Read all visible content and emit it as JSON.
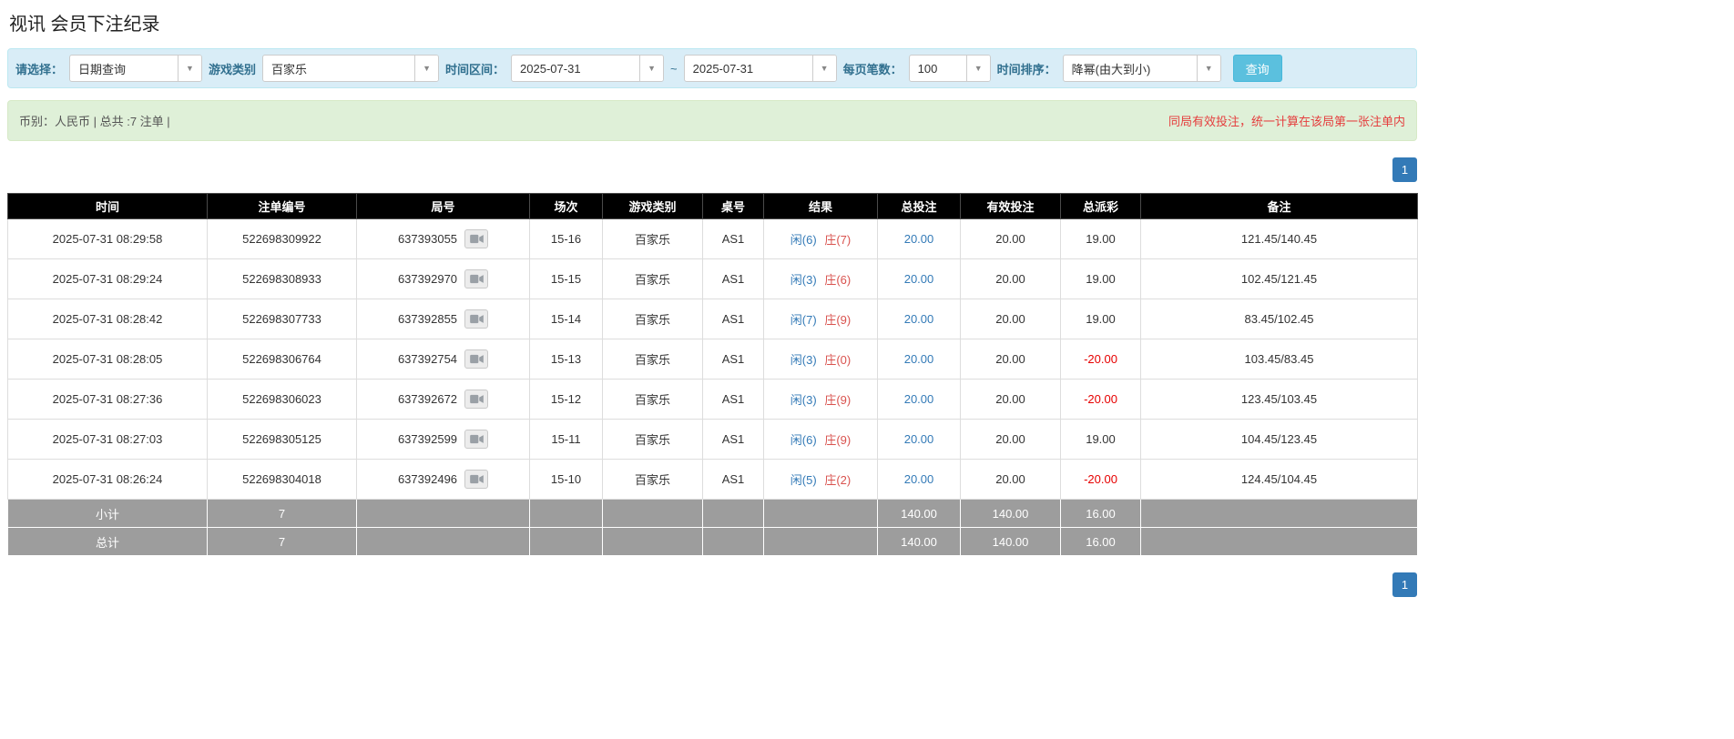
{
  "page": {
    "title": "视讯 会员下注纪录"
  },
  "colors": {
    "accent_blue": "#337ab7",
    "player_blue": "#337ab7",
    "banker_red": "#d9534f",
    "negative_red": "#e60000",
    "filter_bar_bg": "#d9edf7",
    "summary_bar_bg": "#dff0d8",
    "table_header_bg": "#000000",
    "table_footer_bg": "#9d9d9d",
    "search_button_bg": "#5bc0de"
  },
  "filters": {
    "select_label": "请选择：",
    "select_value": "日期查询",
    "game_type_label": "游戏类别",
    "game_type_value": "百家乐",
    "time_range_label": "时间区间：",
    "time_from": "2025-07-31",
    "tilde": "~",
    "time_to": "2025-07-31",
    "page_size_label": "每页笔数：",
    "page_size_value": "100",
    "sort_label": "时间排序：",
    "sort_value": "降幂(由大到小)",
    "search_button": "查询"
  },
  "summary": {
    "left": "币别：人民币 | 总共 :7 注单 |",
    "right": "同局有效投注，统一计算在该局第一张注单内"
  },
  "pagination": {
    "page": "1"
  },
  "table": {
    "headers": [
      "时间",
      "注单编号",
      "局号",
      "场次",
      "游戏类别",
      "桌号",
      "结果",
      "总投注",
      "有效投注",
      "总派彩",
      "备注"
    ],
    "rows": [
      {
        "time": "2025-07-31 08:29:58",
        "bet_id": "522698309922",
        "round_id": "637393055",
        "session": "15-16",
        "game": "百家乐",
        "table_no": "AS1",
        "result_player": "闲(6)",
        "result_banker": "庄(7)",
        "total_bet": "20.00",
        "valid_bet": "20.00",
        "payout": "19.00",
        "note": "121.45/140.45"
      },
      {
        "time": "2025-07-31 08:29:24",
        "bet_id": "522698308933",
        "round_id": "637392970",
        "session": "15-15",
        "game": "百家乐",
        "table_no": "AS1",
        "result_player": "闲(3)",
        "result_banker": "庄(6)",
        "total_bet": "20.00",
        "valid_bet": "20.00",
        "payout": "19.00",
        "note": "102.45/121.45"
      },
      {
        "time": "2025-07-31 08:28:42",
        "bet_id": "522698307733",
        "round_id": "637392855",
        "session": "15-14",
        "game": "百家乐",
        "table_no": "AS1",
        "result_player": "闲(7)",
        "result_banker": "庄(9)",
        "total_bet": "20.00",
        "valid_bet": "20.00",
        "payout": "19.00",
        "note": "83.45/102.45"
      },
      {
        "time": "2025-07-31 08:28:05",
        "bet_id": "522698306764",
        "round_id": "637392754",
        "session": "15-13",
        "game": "百家乐",
        "table_no": "AS1",
        "result_player": "闲(3)",
        "result_banker": "庄(0)",
        "total_bet": "20.00",
        "valid_bet": "20.00",
        "payout": "-20.00",
        "note": "103.45/83.45"
      },
      {
        "time": "2025-07-31 08:27:36",
        "bet_id": "522698306023",
        "round_id": "637392672",
        "session": "15-12",
        "game": "百家乐",
        "table_no": "AS1",
        "result_player": "闲(3)",
        "result_banker": "庄(9)",
        "total_bet": "20.00",
        "valid_bet": "20.00",
        "payout": "-20.00",
        "note": "123.45/103.45"
      },
      {
        "time": "2025-07-31 08:27:03",
        "bet_id": "522698305125",
        "round_id": "637392599",
        "session": "15-11",
        "game": "百家乐",
        "table_no": "AS1",
        "result_player": "闲(6)",
        "result_banker": "庄(9)",
        "total_bet": "20.00",
        "valid_bet": "20.00",
        "payout": "19.00",
        "note": "104.45/123.45"
      },
      {
        "time": "2025-07-31 08:26:24",
        "bet_id": "522698304018",
        "round_id": "637392496",
        "session": "15-10",
        "game": "百家乐",
        "table_no": "AS1",
        "result_player": "闲(5)",
        "result_banker": "庄(2)",
        "total_bet": "20.00",
        "valid_bet": "20.00",
        "payout": "-20.00",
        "note": "124.45/104.45"
      }
    ],
    "subtotal": {
      "label": "小计",
      "count": "7",
      "total_bet": "140.00",
      "valid_bet": "140.00",
      "payout": "16.00"
    },
    "total": {
      "label": "总计",
      "count": "7",
      "total_bet": "140.00",
      "valid_bet": "140.00",
      "payout": "16.00"
    }
  }
}
